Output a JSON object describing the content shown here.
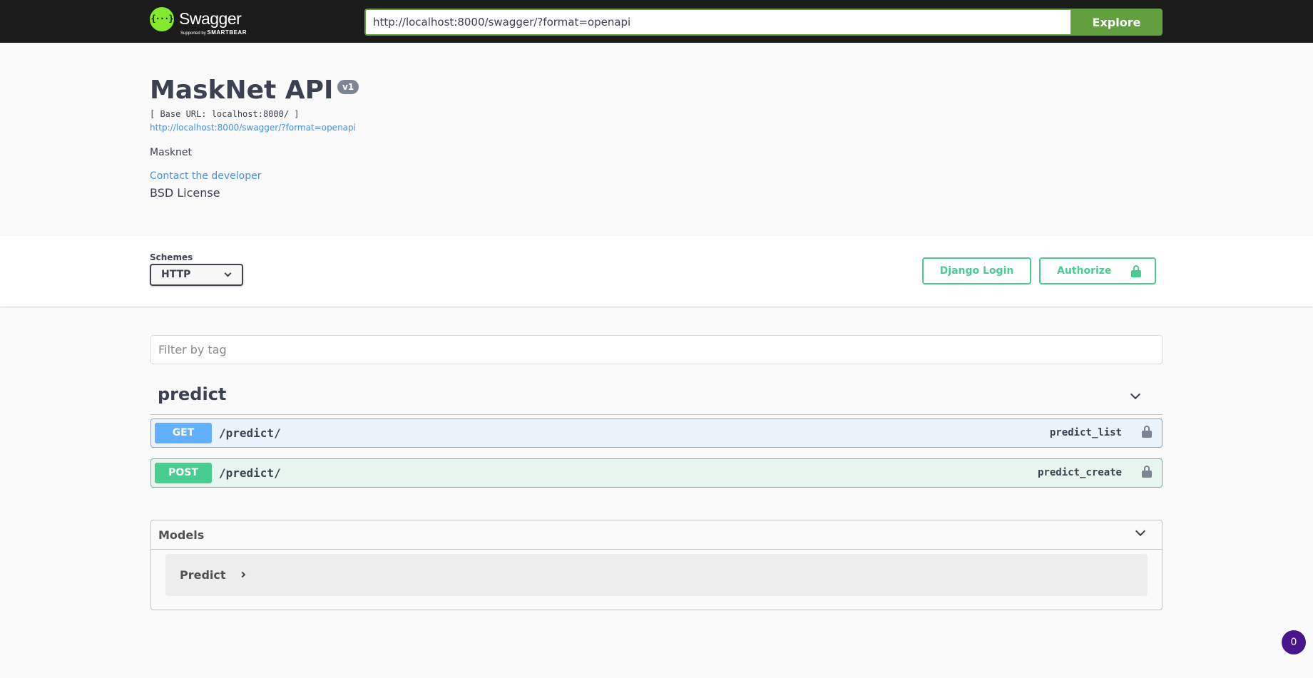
{
  "topbar": {
    "logo_glyph": "{···}",
    "logo_name": "Swagger",
    "logo_sub_prefix": "Supported by",
    "logo_sub_brand": "SMARTBEAR",
    "url_value": "http://localhost:8000/swagger/?format=openapi",
    "explore_label": "Explore"
  },
  "info": {
    "title": "MaskNet API",
    "version": "v1",
    "base_url": "[ Base URL: localhost:8000/ ]",
    "spec_link": "http://localhost:8000/swagger/?format=openapi",
    "description": "Masknet",
    "contact_label": "Contact the developer",
    "license": "BSD License"
  },
  "schemes": {
    "label": "Schemes",
    "selected": "HTTP",
    "django_login_label": "Django Login",
    "authorize_label": "Authorize"
  },
  "filter": {
    "placeholder": "Filter by tag"
  },
  "tag": {
    "name": "predict",
    "operations": [
      {
        "method": "GET",
        "path": "/predict/",
        "operation_id": "predict_list"
      },
      {
        "method": "POST",
        "path": "/predict/",
        "operation_id": "predict_create"
      }
    ]
  },
  "models": {
    "title": "Models",
    "items": [
      {
        "name": "Predict"
      }
    ]
  },
  "counter": "0",
  "colors": {
    "topbar_bg": "#1b1b1b",
    "explore_green": "#62a03f",
    "get_blue": "#61affe",
    "post_green": "#49cc90",
    "link_blue": "#4990e2",
    "counter_purple": "#4a148c"
  }
}
